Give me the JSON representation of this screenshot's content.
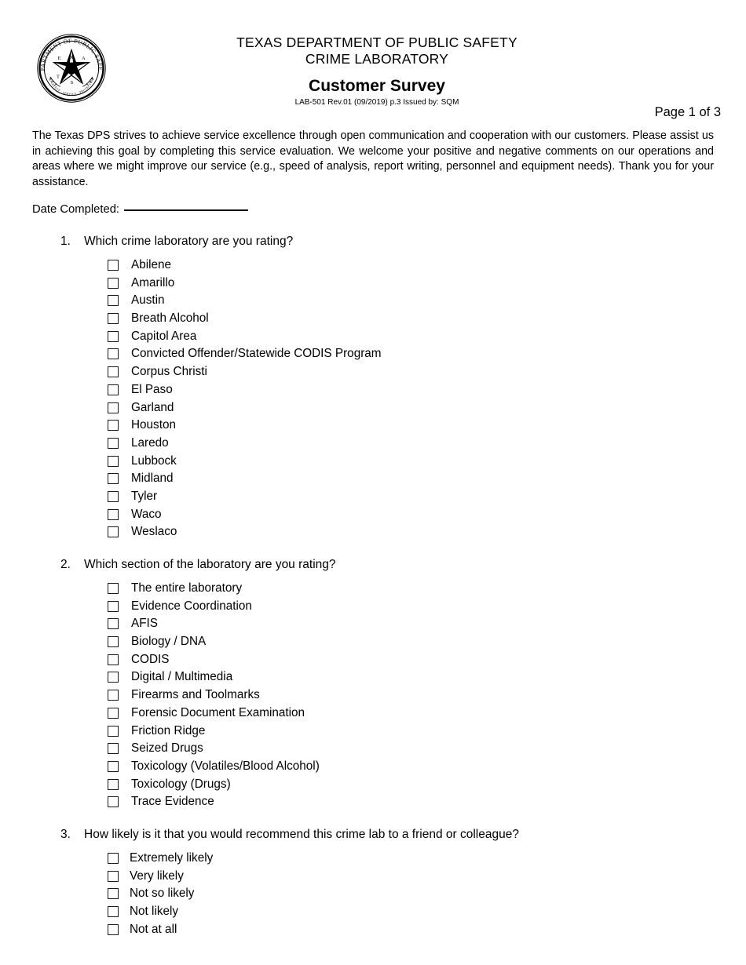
{
  "document": {
    "organization_line1": "TEXAS DEPARTMENT OF PUBLIC SAFETY",
    "organization_line2": "CRIME LABORATORY",
    "title": "Customer Survey",
    "form_meta": "LAB-501 Rev.01 (09/2019) p.3 Issued by: SQM",
    "page_indicator": "Page 1 of 3",
    "intro_paragraph": "The Texas DPS strives to achieve service excellence through open communication and cooperation with our customers. Please assist us in achieving this goal by completing this service evaluation. We welcome your positive and negative comments on our operations and areas where we might improve our service (e.g., speed of analysis, report writing, personnel and equipment needs).  Thank you for your assistance."
  },
  "seal": {
    "top_arc_text": "DEPARTMENT OF PUBLIC SAFETY",
    "bottom_arc_text": "COURTESY · SERVICE · PROTECTION",
    "star_letters": [
      "T",
      "E",
      "X",
      "A",
      "S"
    ]
  },
  "date_field": {
    "label": "Date Completed:",
    "value": "",
    "placeholder": ""
  },
  "questions": [
    {
      "number": "1.",
      "text": "Which crime laboratory are you rating?",
      "options": [
        "Abilene",
        "Amarillo",
        "Austin",
        "Breath Alcohol",
        "Capitol Area",
        "Convicted Offender/Statewide CODIS Program",
        "Corpus Christi",
        "El Paso",
        "Garland",
        "Houston",
        "Laredo",
        "Lubbock",
        "Midland",
        "Tyler",
        "Waco",
        "Weslaco"
      ]
    },
    {
      "number": "2.",
      "text": "Which section of the laboratory are you rating?",
      "options": [
        "The entire laboratory",
        "Evidence Coordination",
        "AFIS",
        "Biology / DNA",
        "CODIS",
        "Digital / Multimedia",
        "Firearms and Toolmarks",
        "Forensic Document Examination",
        "Friction Ridge",
        "Seized Drugs",
        "Toxicology (Volatiles/Blood Alcohol)",
        "Toxicology (Drugs)",
        "Trace Evidence"
      ]
    },
    {
      "number": "3.",
      "text": "How likely is it that you would recommend this crime lab to a friend or colleague?",
      "options": [
        "Extremely likely",
        "Very likely",
        "Not so likely",
        "Not likely",
        "Not at all"
      ]
    }
  ],
  "colors": {
    "text": "#000000",
    "background": "#ffffff",
    "checkbox_border": "#1a1a1a"
  }
}
